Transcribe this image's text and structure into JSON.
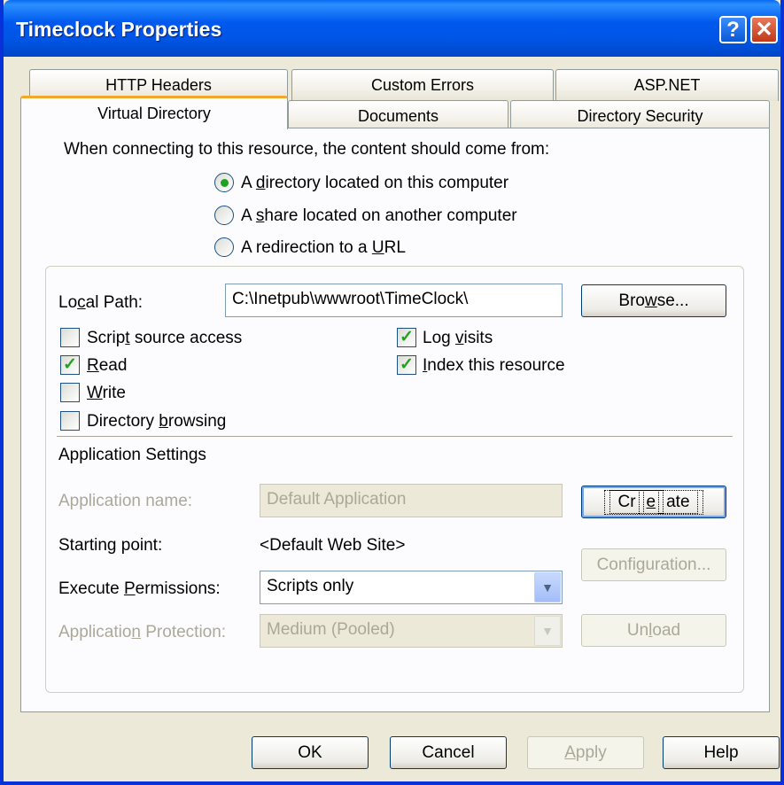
{
  "window": {
    "title": "Timeclock Properties",
    "help_glyph": "?",
    "close_glyph": "✕"
  },
  "tabs_back": [
    "HTTP Headers",
    "Custom Errors",
    "ASP.NET"
  ],
  "tabs_front": [
    "Virtual Directory",
    "Documents",
    "Directory Security"
  ],
  "active_tab": "Virtual Directory",
  "content_source": {
    "prompt": "When connecting to this resource, the content should come from:",
    "options": [
      {
        "pre": "A ",
        "key": "d",
        "post": "irectory located on this computer",
        "selected": true
      },
      {
        "pre": "A ",
        "key": "s",
        "post": "hare located on another computer",
        "selected": false
      },
      {
        "pre": "A redirection to a ",
        "key": "U",
        "post": "RL",
        "selected": false
      }
    ]
  },
  "local_path": {
    "label_pre": "Lo",
    "label_key": "c",
    "label_post": "al Path:",
    "value": "C:\\Inetpub\\wwwroot\\TimeClock\\",
    "browse_pre": "Bro",
    "browse_key": "w",
    "browse_post": "se..."
  },
  "checkboxes_left": [
    {
      "pre": "Scrip",
      "key": "t",
      "post": " source access",
      "checked": false
    },
    {
      "pre": "",
      "key": "R",
      "post": "ead",
      "checked": true
    },
    {
      "pre": "",
      "key": "W",
      "post": "rite",
      "checked": false
    },
    {
      "pre": "Directory ",
      "key": "b",
      "post": "rowsing",
      "checked": false
    }
  ],
  "checkboxes_right": [
    {
      "pre": "Log ",
      "key": "v",
      "post": "isits",
      "checked": true
    },
    {
      "pre": "",
      "key": "I",
      "post": "ndex this resource",
      "checked": true
    }
  ],
  "check_glyph": "✓",
  "app_settings": {
    "heading": "Application Settings",
    "app_name_label": "Application name:",
    "app_name_value": "Default Application",
    "create_pre": "Cr",
    "create_key": "e",
    "create_post": "ate",
    "starting_point_label": "Starting point:",
    "starting_point_value": "<Default Web Site>",
    "configuration_label": "Configuration...",
    "exec_label_pre": "Execute ",
    "exec_label_key": "P",
    "exec_label_post": "ermissions:",
    "exec_value": "Scripts only",
    "protection_label_pre": "Applicatio",
    "protection_label_key": "n",
    "protection_label_post": " Protection:",
    "protection_value": "Medium (Pooled)",
    "unload_pre": "Un",
    "unload_key": "l",
    "unload_post": "oad",
    "dropdown_glyph": "▼"
  },
  "footer": {
    "ok": "OK",
    "cancel": "Cancel",
    "apply_key": "A",
    "apply_post": "pply",
    "help": "Help"
  }
}
